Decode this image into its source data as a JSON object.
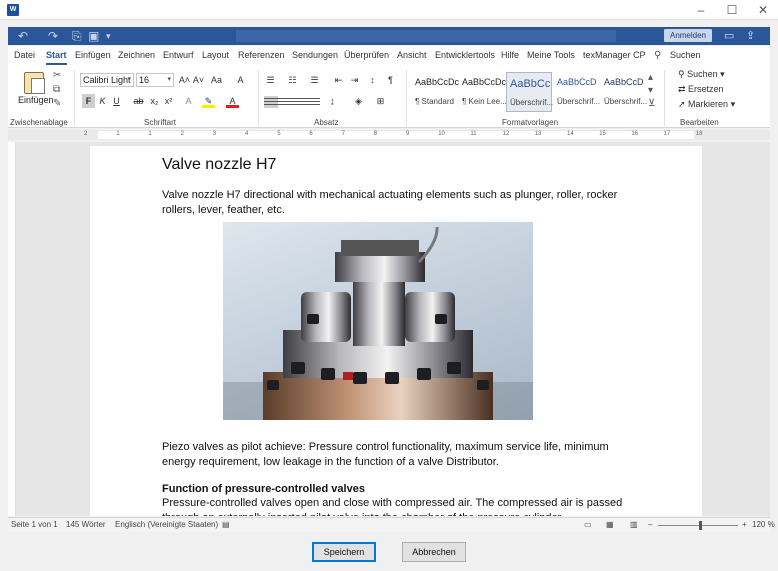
{
  "window": {
    "icon_label": "W"
  },
  "header": {
    "login_label": "Anmelden"
  },
  "tabs": [
    {
      "label": "Datei",
      "active": false
    },
    {
      "label": "Start",
      "active": true
    },
    {
      "label": "Einfügen",
      "active": false
    },
    {
      "label": "Zeichnen",
      "active": false
    },
    {
      "label": "Entwurf",
      "active": false
    },
    {
      "label": "Layout",
      "active": false
    },
    {
      "label": "Referenzen",
      "active": false
    },
    {
      "label": "Sendungen",
      "active": false
    },
    {
      "label": "Überprüfen",
      "active": false
    },
    {
      "label": "Ansicht",
      "active": false
    },
    {
      "label": "Entwicklertools",
      "active": false
    },
    {
      "label": "Hilfe",
      "active": false
    },
    {
      "label": "Meine Tools",
      "active": false
    },
    {
      "label": "texManager CP",
      "active": false
    }
  ],
  "tell_me": {
    "label": "Suchen"
  },
  "ribbon": {
    "clipboard": {
      "paste_label": "Einfügen",
      "group_label": "Zwischenablage"
    },
    "font": {
      "font_name": "Calibri Light",
      "font_size": "16",
      "group_label": "Schriftart"
    },
    "paragraph": {
      "group_label": "Absatz"
    },
    "styles": {
      "group_label": "Formatvorlagen",
      "items": [
        {
          "preview": "AaBbCcDc",
          "name": "¶ Standard"
        },
        {
          "preview": "AaBbCcDc",
          "name": "¶ Kein Lee..."
        },
        {
          "preview": "AaBbCc",
          "name": "Überschrif..."
        },
        {
          "preview": "AaBbCcD",
          "name": "Überschrif..."
        },
        {
          "preview": "AaBbCcD",
          "name": "Überschrif..."
        }
      ]
    },
    "editing": {
      "find_label": "Suchen",
      "replace_label": "Ersetzen",
      "select_label": "Markieren",
      "group_label": "Bearbeiten"
    }
  },
  "ruler": {
    "ticks": [
      "2",
      "1",
      "1",
      "2",
      "3",
      "4",
      "5",
      "6",
      "7",
      "8",
      "9",
      "10",
      "11",
      "12",
      "13",
      "14",
      "15",
      "16",
      "17",
      "18"
    ]
  },
  "document": {
    "title": "Valve nozzle H7",
    "intro": "Valve nozzle H7 directional with mechanical actuating elements such as plunger, roller, rocker rollers, lever, feather, etc.",
    "image_alt": "Valve nozzle H7 photo",
    "piezo": "Piezo valves as pilot achieve: Pressure control functionality, maximum service life, minimum energy requirement, low leakage in the function of a valve Distributor.",
    "section_heading": "Function of pressure-controlled valves",
    "section_text": "Pressure-controlled valves open and close with compressed air. The compressed air is passed through an externally inserted pilot valve into the chamber of the pressure cylinder."
  },
  "status": {
    "page": "Seite 1 von 1",
    "words": "145 Wörter",
    "language": "Englisch (Vereinigte Staaten)",
    "zoom_minus": "–",
    "zoom_plus": "+",
    "zoom": "120 %"
  },
  "dialog": {
    "save_label": "Speichern",
    "cancel_label": "Abbrechen"
  }
}
